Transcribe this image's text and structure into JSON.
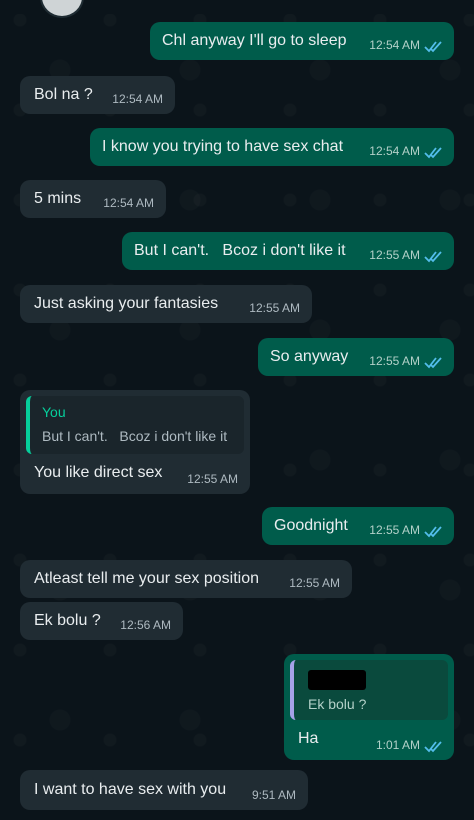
{
  "colors": {
    "chat_background": "#0b141a",
    "incoming_bubble": "#202c33",
    "outgoing_bubble": "#005c4b",
    "read_ticks": "#53bdeb",
    "quote_accent": "#06cf9c"
  },
  "messages": [
    {
      "dir": "out",
      "text": "Chl anyway I'll go to sleep",
      "time": "12:54 AM",
      "status": "read"
    },
    {
      "dir": "in",
      "text": "Bol na ?",
      "time": "12:54 AM"
    },
    {
      "dir": "out",
      "text": "I know you trying to have sex chat",
      "time": "12:54 AM",
      "status": "read"
    },
    {
      "dir": "in",
      "text": "5 mins",
      "time": "12:54 AM"
    },
    {
      "dir": "out",
      "text": "But I can't.   Bcoz i don't like it",
      "time": "12:55 AM",
      "status": "read"
    },
    {
      "dir": "in",
      "text": "Just asking your fantasies",
      "time": "12:55 AM"
    },
    {
      "dir": "out",
      "text": "So anyway",
      "time": "12:55 AM",
      "status": "read"
    },
    {
      "dir": "in",
      "reply_name": "You",
      "reply_text": "But I can't.   Bcoz i don't like it",
      "text": "You like direct sex",
      "time": "12:55 AM"
    },
    {
      "dir": "out",
      "text": "Goodnight",
      "time": "12:55 AM",
      "status": "read"
    },
    {
      "dir": "in",
      "text": "Atleast tell me your sex position",
      "time": "12:55 AM"
    },
    {
      "dir": "in",
      "text": "Ek bolu ?",
      "time": "12:56 AM"
    },
    {
      "dir": "out",
      "reply_text": "Ek bolu ?",
      "text": "Ha",
      "time": "1:01 AM",
      "status": "read"
    },
    {
      "dir": "in",
      "text": "I want to have sex with you",
      "time": "9:51 AM"
    }
  ]
}
